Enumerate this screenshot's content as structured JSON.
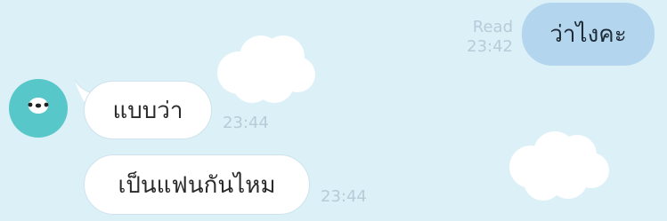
{
  "chat": {
    "outgoing": [
      {
        "text": "ว่าไงคะ",
        "read_label": "Read",
        "time": "23:42"
      }
    ],
    "incoming": [
      {
        "text": "แบบว่า",
        "time": "23:44"
      },
      {
        "text": "เป็นแฟนกันไหม",
        "time": "23:44"
      }
    ]
  },
  "theme": {
    "background": "#dcf0f7",
    "outgoing_bubble": "#b3d6ee",
    "incoming_bubble": "#ffffff",
    "avatar": "#57c7c9",
    "meta_text": "#b6ccd8"
  },
  "icons": {
    "avatar": "bear-face-icon",
    "decor": "cloud-icon"
  }
}
